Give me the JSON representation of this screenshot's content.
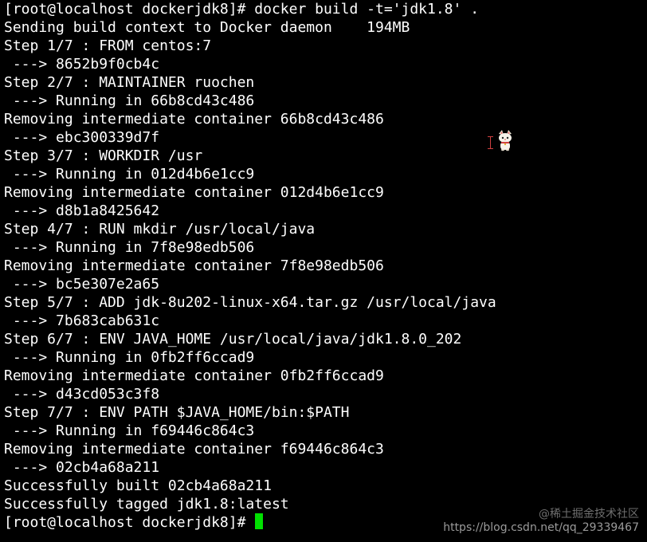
{
  "terminal": {
    "lines": [
      "[root@localhost dockerjdk8]# docker build -t='jdk1.8' .",
      "Sending build context to Docker daemon    194MB",
      "Step 1/7 : FROM centos:7",
      " ---> 8652b9f0cb4c",
      "Step 2/7 : MAINTAINER ruochen",
      " ---> Running in 66b8cd43c486",
      "Removing intermediate container 66b8cd43c486",
      " ---> ebc300339d7f",
      "Step 3/7 : WORKDIR /usr",
      " ---> Running in 012d4b6e1cc9",
      "Removing intermediate container 012d4b6e1cc9",
      " ---> d8b1a8425642",
      "Step 4/7 : RUN mkdir /usr/local/java",
      " ---> Running in 7f8e98edb506",
      "Removing intermediate container 7f8e98edb506",
      " ---> bc5e307e2a65",
      "Step 5/7 : ADD jdk-8u202-linux-x64.tar.gz /usr/local/java",
      " ---> 7b683cab631c",
      "Step 6/7 : ENV JAVA_HOME /usr/local/java/jdk1.8.0_202",
      " ---> Running in 0fb2ff6ccad9",
      "Removing intermediate container 0fb2ff6ccad9",
      " ---> d43cd053c3f8",
      "Step 7/7 : ENV PATH $JAVA_HOME/bin:$PATH",
      " ---> Running in f69446c864c3",
      "Removing intermediate container f69446c864c3",
      " ---> 02cb4a68a211",
      "Successfully built 02cb4a68a211",
      "Successfully tagged jdk1.8:latest"
    ],
    "prompt": "[root@localhost dockerjdk8]# ",
    "colors": {
      "background": "#000000",
      "text": "#ffffff",
      "cursor": "#00e000"
    }
  },
  "overlay": {
    "ibeam_icon": "text-cursor-icon",
    "mascot_icon": "cat-mascot-icon"
  },
  "watermark": {
    "top": "@稀土掘金技术社区",
    "bottom": "https://blog.csdn.net/qq_29339467"
  }
}
